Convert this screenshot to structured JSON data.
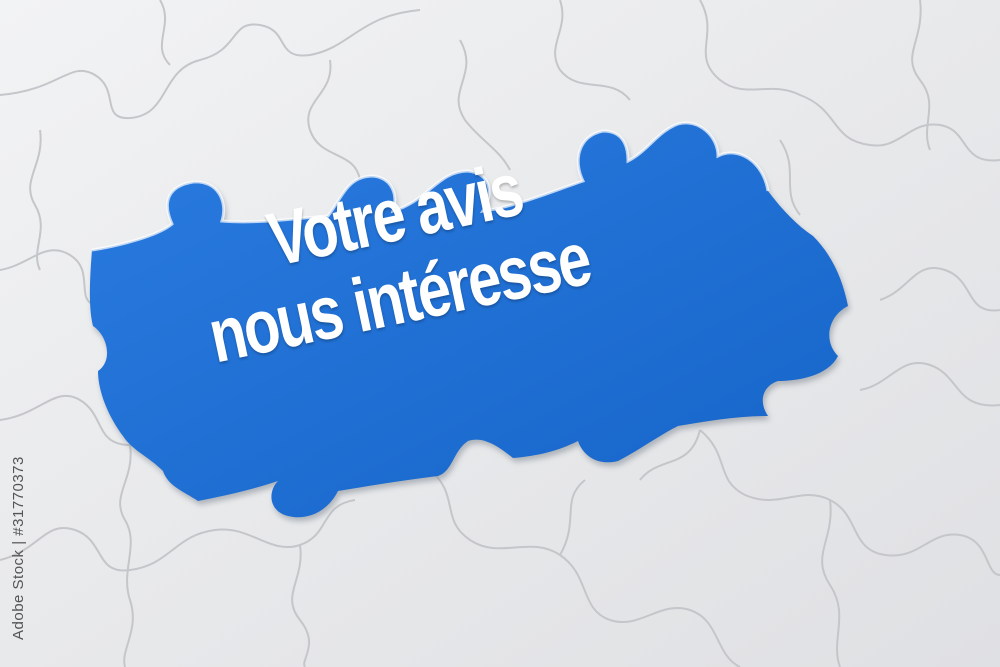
{
  "headline": {
    "line1": "Votre avis",
    "line2": "nous intéresse"
  },
  "side_id": "Adobe Stock | #31770373",
  "colors": {
    "puzzle_white": "#ececee",
    "hole_blue": "#1f72d6",
    "seam": "#c6c8cc",
    "text": "#ffffff"
  }
}
